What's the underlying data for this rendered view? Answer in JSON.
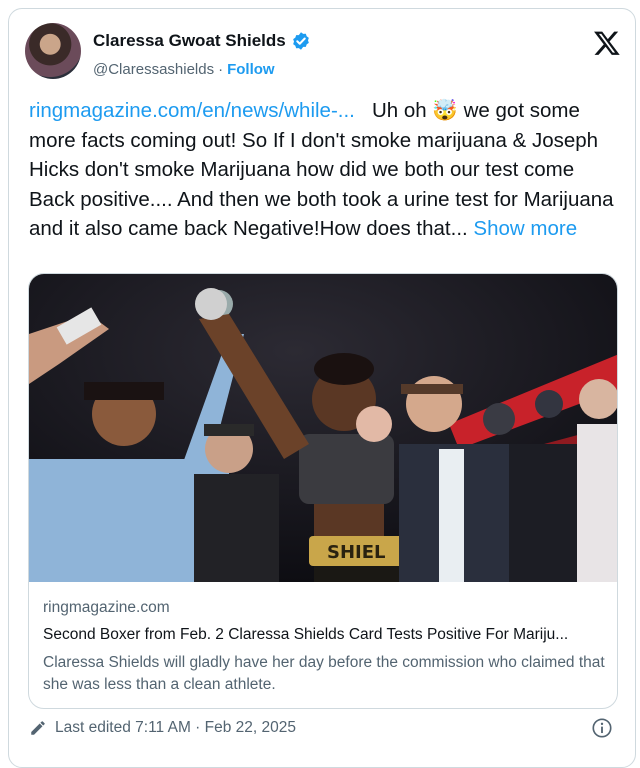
{
  "author": {
    "name": "Claressa Gwoat Shields",
    "handle": "@Claressashields",
    "follow_label": "Follow",
    "separator": "·"
  },
  "tweet": {
    "link_text": "ringmagazine.com/en/news/while-...",
    "body_line1": "Uh oh",
    "emoji": "🤯",
    "body_rest": "we got some more facts coming out! So If I don't smoke marijuana & Joseph Hicks don't smoke Marijuana how did we both our test come Back positive.... And then we both took a urine test for Marijuana and it also came back Negative!How does that...",
    "show_more": "Show more"
  },
  "link_card": {
    "domain": "ringmagazine.com",
    "title": "Second Boxer from Feb. 2 Claressa Shields Card Tests Positive For Mariju...",
    "description": "Claressa Shields will gladly have her day before the commission who claimed that she was less than a clean athlete.",
    "photo_belt_text": "SHIEL"
  },
  "footer": {
    "edited_text": "Last edited 7:11 AM · Feb 22, 2025"
  },
  "icons": {
    "brand": "x-logo-icon",
    "verified": "verified-badge-icon",
    "edit": "pencil-icon",
    "info": "info-icon"
  },
  "colors": {
    "accent": "#1d9bf0",
    "text": "#0f1419",
    "muted": "#536471",
    "border": "#cfd9de"
  }
}
